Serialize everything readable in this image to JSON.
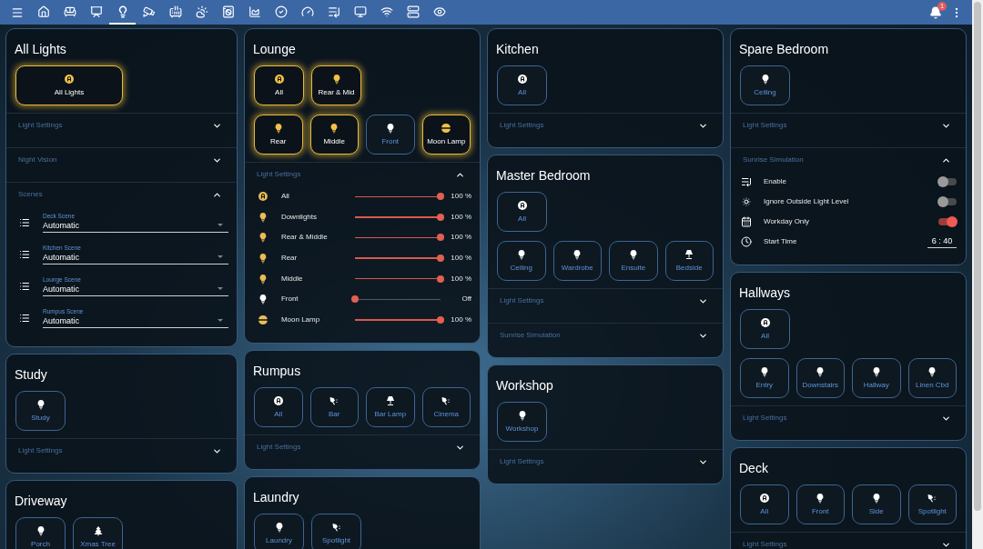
{
  "top_bar": {
    "tabs": [
      {
        "selected": false
      },
      {
        "selected": false
      },
      {
        "selected": false
      },
      {
        "selected": true
      },
      {
        "selected": false
      },
      {
        "selected": false
      },
      {
        "selected": false
      },
      {
        "selected": false
      },
      {
        "selected": false
      },
      {
        "selected": false
      },
      {
        "selected": false
      },
      {
        "selected": false
      },
      {
        "selected": false
      },
      {
        "selected": false
      },
      {
        "selected": false
      },
      {
        "selected": false
      }
    ],
    "notification_badge": "1"
  },
  "columns": [
    [
      {
        "title": "All Lights",
        "button_rows": [
          [
            {
              "label": "All Lights",
              "kind": "master",
              "on": true
            }
          ]
        ],
        "sections": [
          {
            "title": "Light Settings",
            "expanded": false
          },
          {
            "title": "Night Vision",
            "expanded": false
          },
          {
            "title": "Scenes",
            "expanded": true,
            "scenes": [
              {
                "label": "Deck Scene",
                "value": "Automatic"
              },
              {
                "label": "Kitchen Scene",
                "value": "Automatic"
              },
              {
                "label": "Lounge Scene",
                "value": "Automatic"
              },
              {
                "label": "Rumpus Scene",
                "value": "Automatic"
              }
            ]
          }
        ]
      },
      {
        "title": "Study",
        "button_rows": [
          [
            {
              "label": "Study",
              "kind": "bulb",
              "on": false
            }
          ]
        ],
        "sections": [
          {
            "title": "Light Settings",
            "expanded": false
          }
        ]
      },
      {
        "title": "Driveway",
        "button_rows": [
          [
            {
              "label": "Porch",
              "kind": "bulb",
              "on": false
            },
            {
              "label": "Xmas Tree",
              "kind": "tree",
              "on": false
            }
          ]
        ]
      }
    ],
    [
      {
        "title": "Lounge",
        "button_rows": [
          [
            {
              "label": "All",
              "kind": "group",
              "on": true
            },
            {
              "label": "Rear & Mid",
              "kind": "bulb",
              "on": true
            }
          ],
          [
            {
              "label": "Rear",
              "kind": "bulb",
              "on": true
            },
            {
              "label": "Middle",
              "kind": "bulb",
              "on": true
            },
            {
              "label": "Front",
              "kind": "bulb",
              "on": false
            },
            {
              "label": "Moon Lamp",
              "kind": "moon",
              "on": true
            }
          ]
        ],
        "sections": [
          {
            "title": "Light Settings",
            "expanded": true,
            "sliders": [
              {
                "kind": "group",
                "label": "All",
                "level": 1,
                "reading": "100 %",
                "on": true
              },
              {
                "kind": "bulb",
                "label": "Downlights",
                "level": 1,
                "reading": "100 %",
                "on": true
              },
              {
                "kind": "bulb",
                "label": "Rear & Middle",
                "level": 1,
                "reading": "100 %",
                "on": true
              },
              {
                "kind": "bulb",
                "label": "Rear",
                "level": 1,
                "reading": "100 %",
                "on": true
              },
              {
                "kind": "bulb",
                "label": "Middle",
                "level": 1,
                "reading": "100 %",
                "on": true
              },
              {
                "kind": "bulb",
                "label": "Front",
                "level": 0,
                "reading": "Off",
                "on": false
              },
              {
                "kind": "moon",
                "label": "Moon Lamp",
                "level": 1,
                "reading": "100 %",
                "on": true
              }
            ]
          }
        ]
      },
      {
        "title": "Rumpus",
        "button_rows": [
          [
            {
              "label": "All",
              "kind": "group",
              "on": false
            },
            {
              "label": "Bar",
              "kind": "spot",
              "on": false
            },
            {
              "label": "Bar Lamp",
              "kind": "lamp",
              "on": false
            },
            {
              "label": "Cinema",
              "kind": "spot",
              "on": false
            }
          ]
        ],
        "sections": [
          {
            "title": "Light Settings",
            "expanded": false
          }
        ]
      },
      {
        "title": "Laundry",
        "button_rows": [
          [
            {
              "label": "Laundry",
              "kind": "bulb",
              "on": false
            },
            {
              "label": "Spotlight",
              "kind": "spot",
              "on": false
            }
          ]
        ]
      }
    ],
    [
      {
        "title": "Kitchen",
        "button_rows": [
          [
            {
              "label": "All",
              "kind": "group",
              "on": false
            }
          ]
        ],
        "sections": [
          {
            "title": "Light Settings",
            "expanded": false
          }
        ]
      },
      {
        "title": "Master Bedroom",
        "button_rows": [
          [
            {
              "label": "All",
              "kind": "group",
              "on": false
            }
          ],
          [
            {
              "label": "Ceiling",
              "kind": "bulb",
              "on": false
            },
            {
              "label": "Wardrobe",
              "kind": "bulb",
              "on": false
            },
            {
              "label": "Ensuite",
              "kind": "bulb",
              "on": false
            },
            {
              "label": "Bedside",
              "kind": "lamp",
              "on": false
            }
          ]
        ],
        "sections": [
          {
            "title": "Light Settings",
            "expanded": false
          },
          {
            "title": "Sunrise Simulation",
            "expanded": false
          }
        ]
      },
      {
        "title": "Workshop",
        "button_rows": [
          [
            {
              "label": "Workshop",
              "kind": "bulb",
              "on": false
            }
          ]
        ],
        "sections": [
          {
            "title": "Light Settings",
            "expanded": false
          }
        ]
      }
    ],
    [
      {
        "title": "Spare Bedroom",
        "button_rows": [
          [
            {
              "label": "Ceiling",
              "kind": "bulb",
              "on": false
            }
          ]
        ],
        "sections": [
          {
            "title": "Light Settings",
            "expanded": false
          },
          {
            "title": "Sunrise Simulation",
            "expanded": true,
            "controls": [
              {
                "kind": "playlist",
                "label": "Enable",
                "on": false
              },
              {
                "kind": "sun_off",
                "label": "Ignore Outside Light Level",
                "on": false
              },
              {
                "kind": "calendar",
                "label": "Workday Only",
                "on": true
              },
              {
                "kind": "clock",
                "label": "Start Time",
                "value": "6 : 40"
              }
            ]
          }
        ]
      },
      {
        "title": "Hallways",
        "button_rows": [
          [
            {
              "label": "All",
              "kind": "group",
              "on": false
            }
          ],
          [
            {
              "label": "Entry",
              "kind": "bulb",
              "on": false
            },
            {
              "label": "Downstairs",
              "kind": "bulb",
              "on": false
            },
            {
              "label": "Hallway",
              "kind": "bulb",
              "on": false
            },
            {
              "label": "Linen Cbd",
              "kind": "bulb",
              "on": false
            }
          ]
        ],
        "sections": [
          {
            "title": "Light Settings",
            "expanded": false
          }
        ]
      },
      {
        "title": "Deck",
        "button_rows": [
          [
            {
              "label": "All",
              "kind": "group",
              "on": false
            },
            {
              "label": "Front",
              "kind": "bulb",
              "on": false
            },
            {
              "label": "Side",
              "kind": "bulb",
              "on": false
            },
            {
              "label": "Spotlight",
              "kind": "spot",
              "on": false
            }
          ]
        ],
        "sections": [
          {
            "title": "Light Settings",
            "expanded": false
          }
        ]
      }
    ]
  ]
}
